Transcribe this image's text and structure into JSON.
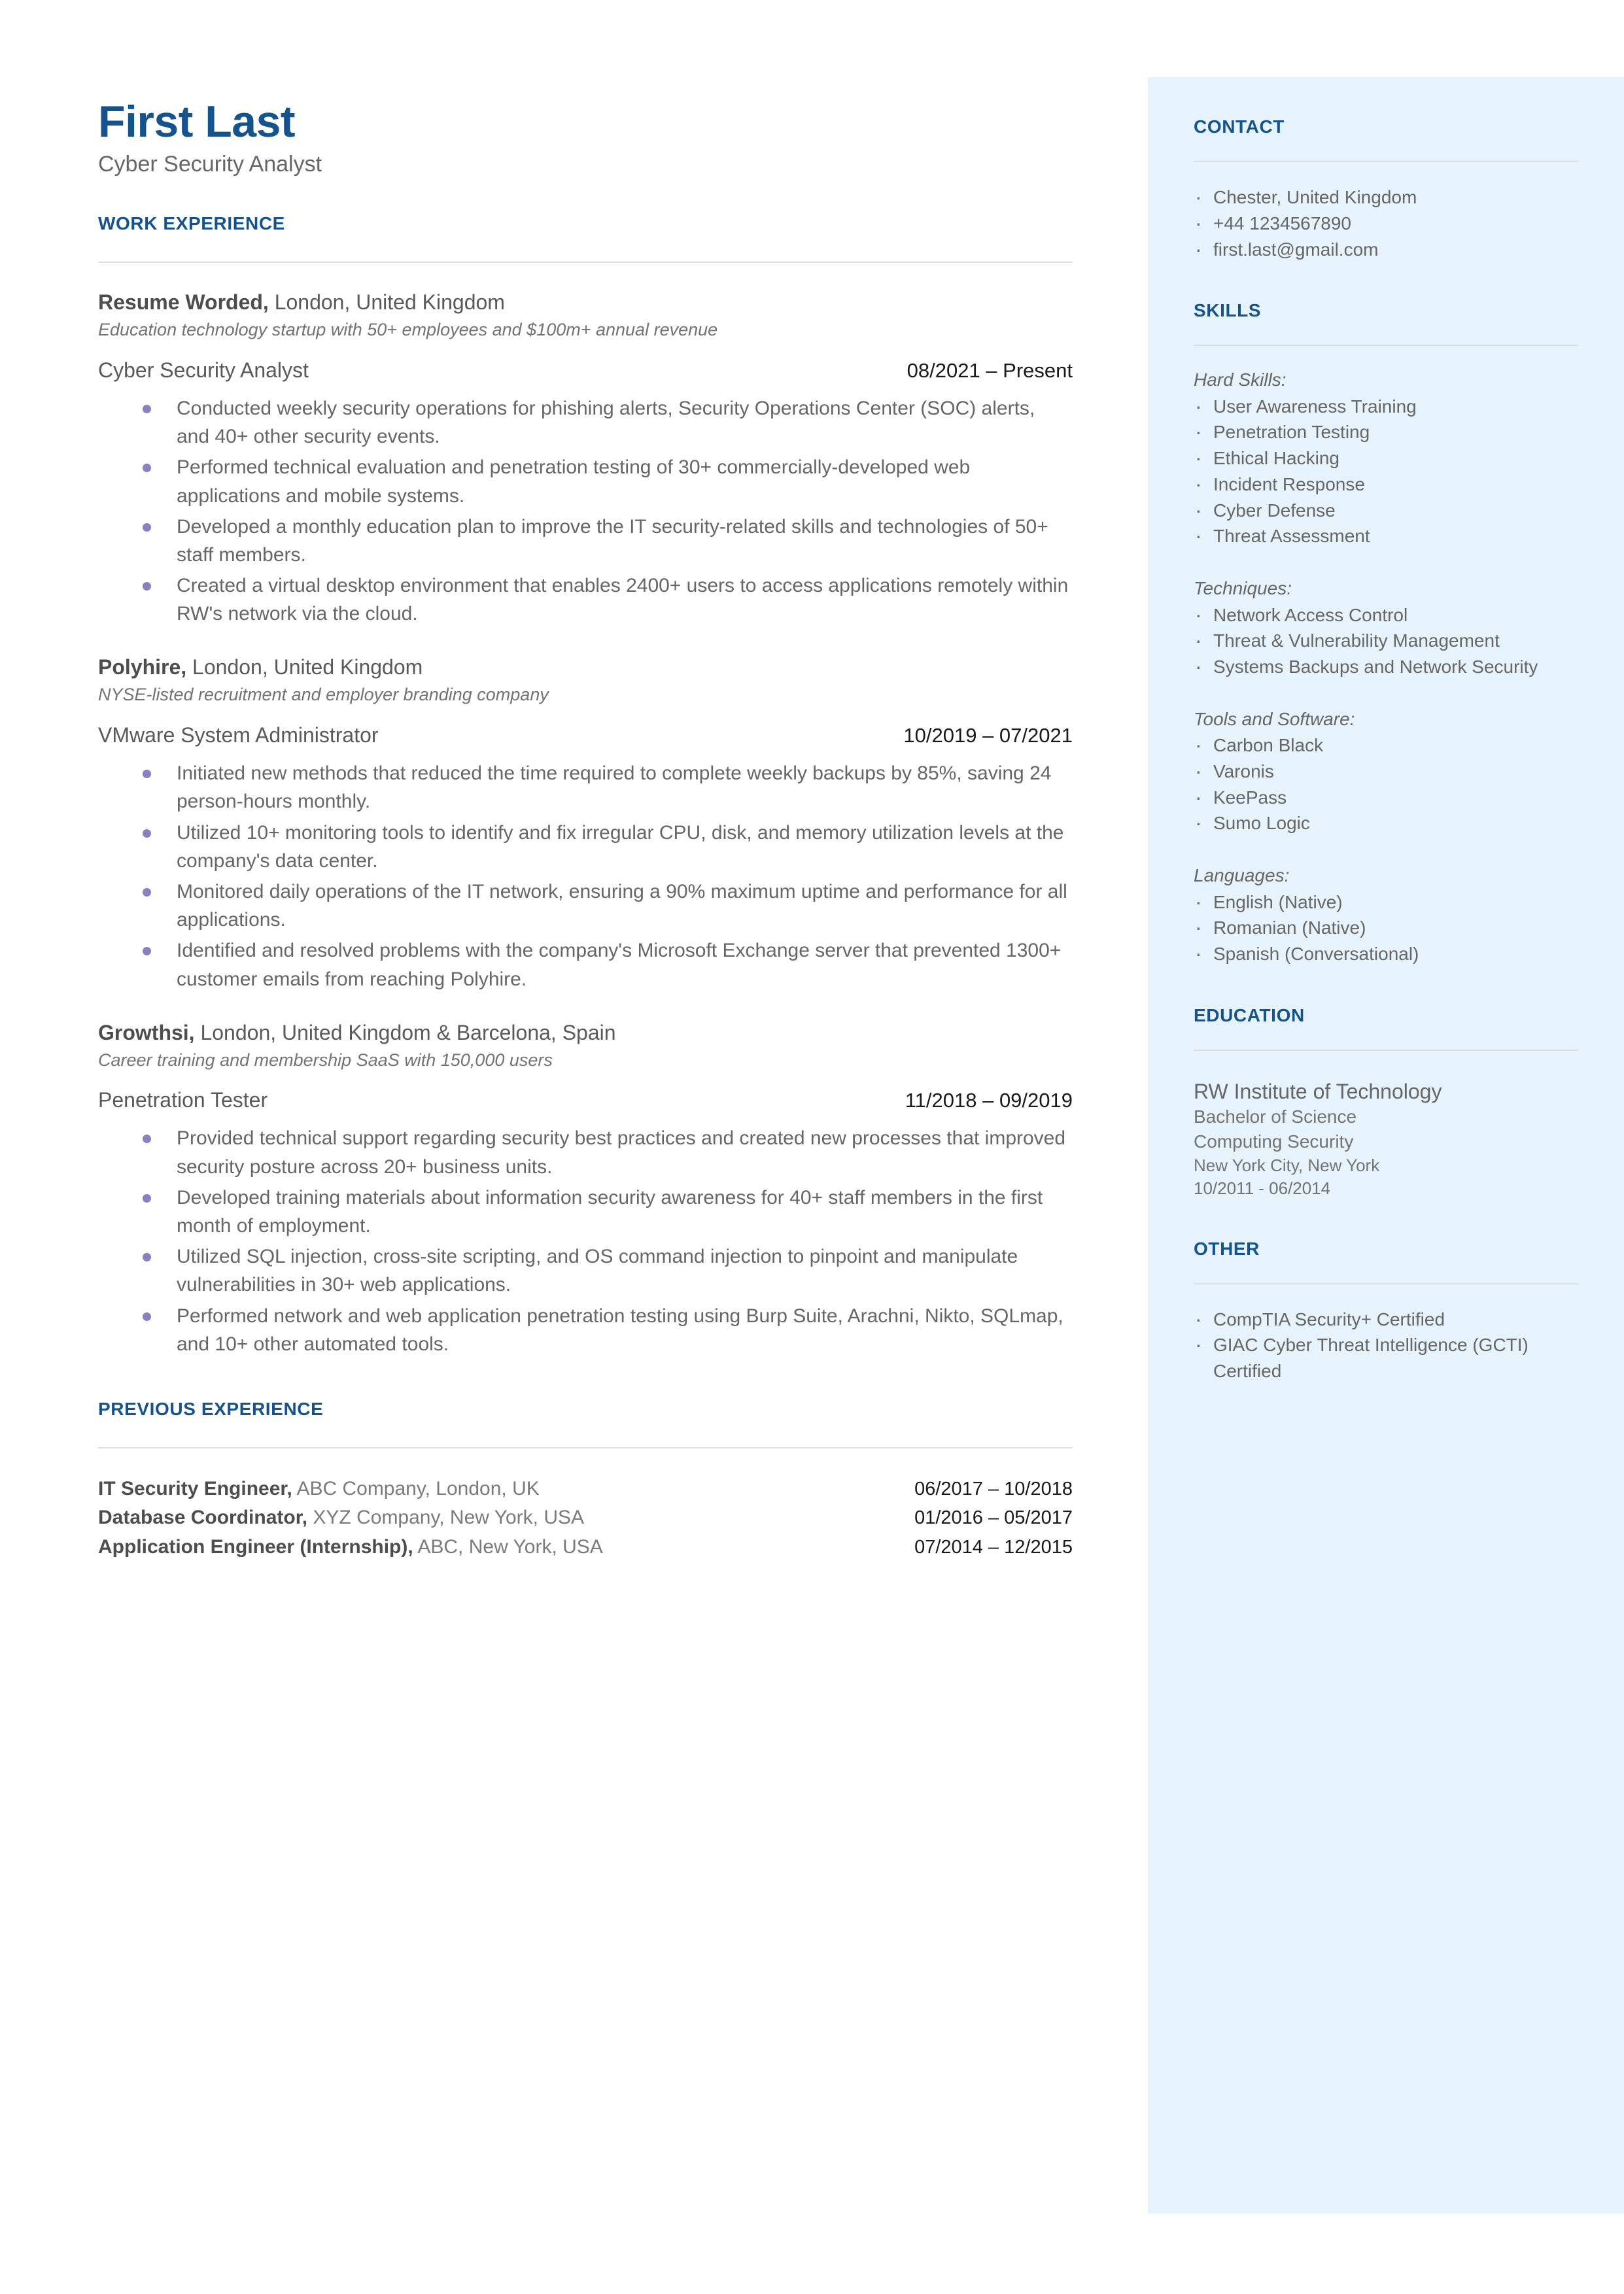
{
  "header": {
    "name": "First Last",
    "headline": "Cyber Security Analyst"
  },
  "colors": {
    "accent_blue": "#15538f",
    "sidebar_bg": "#e6f3fd",
    "bullet_purple": "#8a7fc0",
    "body_text": "#666666"
  },
  "main": {
    "work_experience": {
      "title": "WORK EXPERIENCE",
      "jobs": [
        {
          "company": "Resume Worded,",
          "location": " London, United Kingdom",
          "description": "Education technology startup with 50+ employees and $100m+ annual revenue",
          "role": "Cyber Security Analyst",
          "dates": "08/2021 – Present",
          "bullets": [
            "Conducted weekly security operations for phishing alerts, Security Operations Center (SOC) alerts, and 40+ other security events.",
            "Performed technical evaluation and penetration testing of 30+ commercially-developed web applications and mobile systems.",
            "Developed a monthly education plan to improve the IT security-related skills and technologies of 50+ staff members.",
            "Created a virtual desktop environment that enables 2400+ users to access applications remotely within RW's network via the cloud."
          ]
        },
        {
          "company": "Polyhire,",
          "location": " London, United Kingdom",
          "description": "NYSE-listed recruitment and employer branding company",
          "role": "VMware System Administrator",
          "dates": "10/2019 – 07/2021",
          "bullets": [
            "Initiated new methods that reduced the time required to complete weekly backups by 85%, saving 24 person-hours monthly.",
            "Utilized 10+ monitoring tools to identify and fix irregular CPU, disk, and memory utilization levels at the company's data center.",
            "Monitored daily operations of the IT network, ensuring a 90% maximum uptime and performance for all applications.",
            "Identified and resolved problems with the company's Microsoft Exchange server that prevented 1300+ customer emails from reaching Polyhire."
          ]
        },
        {
          "company": "Growthsi,",
          "location": " London, United Kingdom & Barcelona, Spain",
          "description": "Career training and membership SaaS with 150,000 users",
          "role": "Penetration Tester",
          "dates": "11/2018 – 09/2019",
          "bullets": [
            "Provided technical support regarding security best practices and created new processes that improved security posture across 20+ business units.",
            "Developed training materials about information security awareness for 40+ staff members in the first month of employment.",
            "Utilized SQL injection, cross-site scripting, and OS command injection to pinpoint and manipulate vulnerabilities in 30+ web applications.",
            "Performed network and web application penetration testing using Burp Suite, Arachni, Nikto, SQLmap, and 10+ other automated tools."
          ]
        }
      ]
    },
    "previous_experience": {
      "title": "PREVIOUS EXPERIENCE",
      "rows": [
        {
          "role": "IT Security Engineer,",
          "company": " ABC Company, London, UK",
          "dates": "06/2017 – 10/2018"
        },
        {
          "role": "Database Coordinator,",
          "company": " XYZ Company, New York, USA",
          "dates": "01/2016 – 05/2017"
        },
        {
          "role": "Application Engineer (Internship),",
          "company": " ABC, New York, USA",
          "dates": "07/2014 – 12/2015"
        }
      ]
    }
  },
  "sidebar": {
    "contact": {
      "title": "CONTACT",
      "items": [
        "Chester, United Kingdom",
        "+44 1234567890",
        "first.last@gmail.com"
      ]
    },
    "skills": {
      "title": "SKILLS",
      "groups": [
        {
          "label": "Hard Skills:",
          "items": [
            "User Awareness Training",
            "Penetration Testing",
            "Ethical Hacking",
            "Incident Response",
            "Cyber Defense",
            "Threat Assessment"
          ]
        },
        {
          "label": "Techniques:",
          "items": [
            "Network Access Control",
            "Threat & Vulnerability Management",
            "Systems Backups and Network Security"
          ]
        },
        {
          "label": "Tools and Software:",
          "items": [
            "Carbon Black",
            "Varonis",
            "KeePass",
            "Sumo Logic"
          ]
        },
        {
          "label": "Languages:",
          "items": [
            "English (Native)",
            "Romanian (Native)",
            "Spanish (Conversational)"
          ]
        }
      ]
    },
    "education": {
      "title": "EDUCATION",
      "school": "RW Institute of Technology",
      "degree": "Bachelor of Science",
      "field": "Computing Security",
      "location": "New York City, New York",
      "dates": "10/2011 - 06/2014"
    },
    "other": {
      "title": "OTHER",
      "items": [
        "CompTIA Security+ Certified",
        "GIAC Cyber Threat Intelligence (GCTI) Certified"
      ]
    }
  }
}
